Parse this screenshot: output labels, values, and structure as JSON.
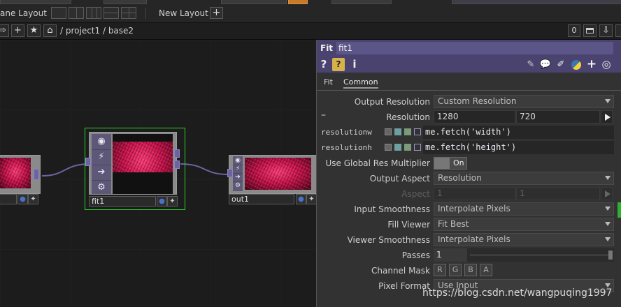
{
  "layout_bar": {
    "pane_layout_label": "ane Layout",
    "new_layout_label": "New Layout",
    "new_layout_add": "+"
  },
  "path_bar": {
    "path": "/ project1 / base2",
    "counter": "0"
  },
  "nodes": {
    "fit1": {
      "name": "fit1"
    },
    "out1": {
      "name": "out1"
    }
  },
  "panel": {
    "op_type": "Fit",
    "op_name": "fit1",
    "toolbar": {
      "help": "?",
      "info": "i",
      "add": "+"
    },
    "tabs": [
      "Fit",
      "Common"
    ],
    "params": {
      "output_resolution": {
        "label": "Output Resolution",
        "value": "Custom Resolution"
      },
      "resolution": {
        "label": "Resolution",
        "minus": "–",
        "w": "1280",
        "h": "720"
      },
      "resolutionw": {
        "label": "resolutionw",
        "expr": "me.fetch('width')"
      },
      "resolutionh": {
        "label": "resolutionh",
        "expr": "me.fetch('height')"
      },
      "global_res": {
        "label": "Use Global Res Multiplier",
        "value": "On"
      },
      "output_aspect": {
        "label": "Output Aspect",
        "value": "Resolution"
      },
      "aspect": {
        "label": "Aspect",
        "a": "1",
        "b": "1"
      },
      "input_smoothness": {
        "label": "Input Smoothness",
        "value": "Interpolate Pixels"
      },
      "fill_viewer": {
        "label": "Fill Viewer",
        "value": "Fit Best"
      },
      "viewer_smoothness": {
        "label": "Viewer Smoothness",
        "value": "Interpolate Pixels"
      },
      "passes": {
        "label": "Passes",
        "value": "1"
      },
      "channel_mask": {
        "label": "Channel Mask",
        "channels": [
          "R",
          "G",
          "B",
          "A"
        ]
      },
      "pixel_format": {
        "label": "Pixel Format",
        "value": "Use Input"
      }
    }
  },
  "watermark": "https://blog.csdn.net/wangpuqing1997"
}
